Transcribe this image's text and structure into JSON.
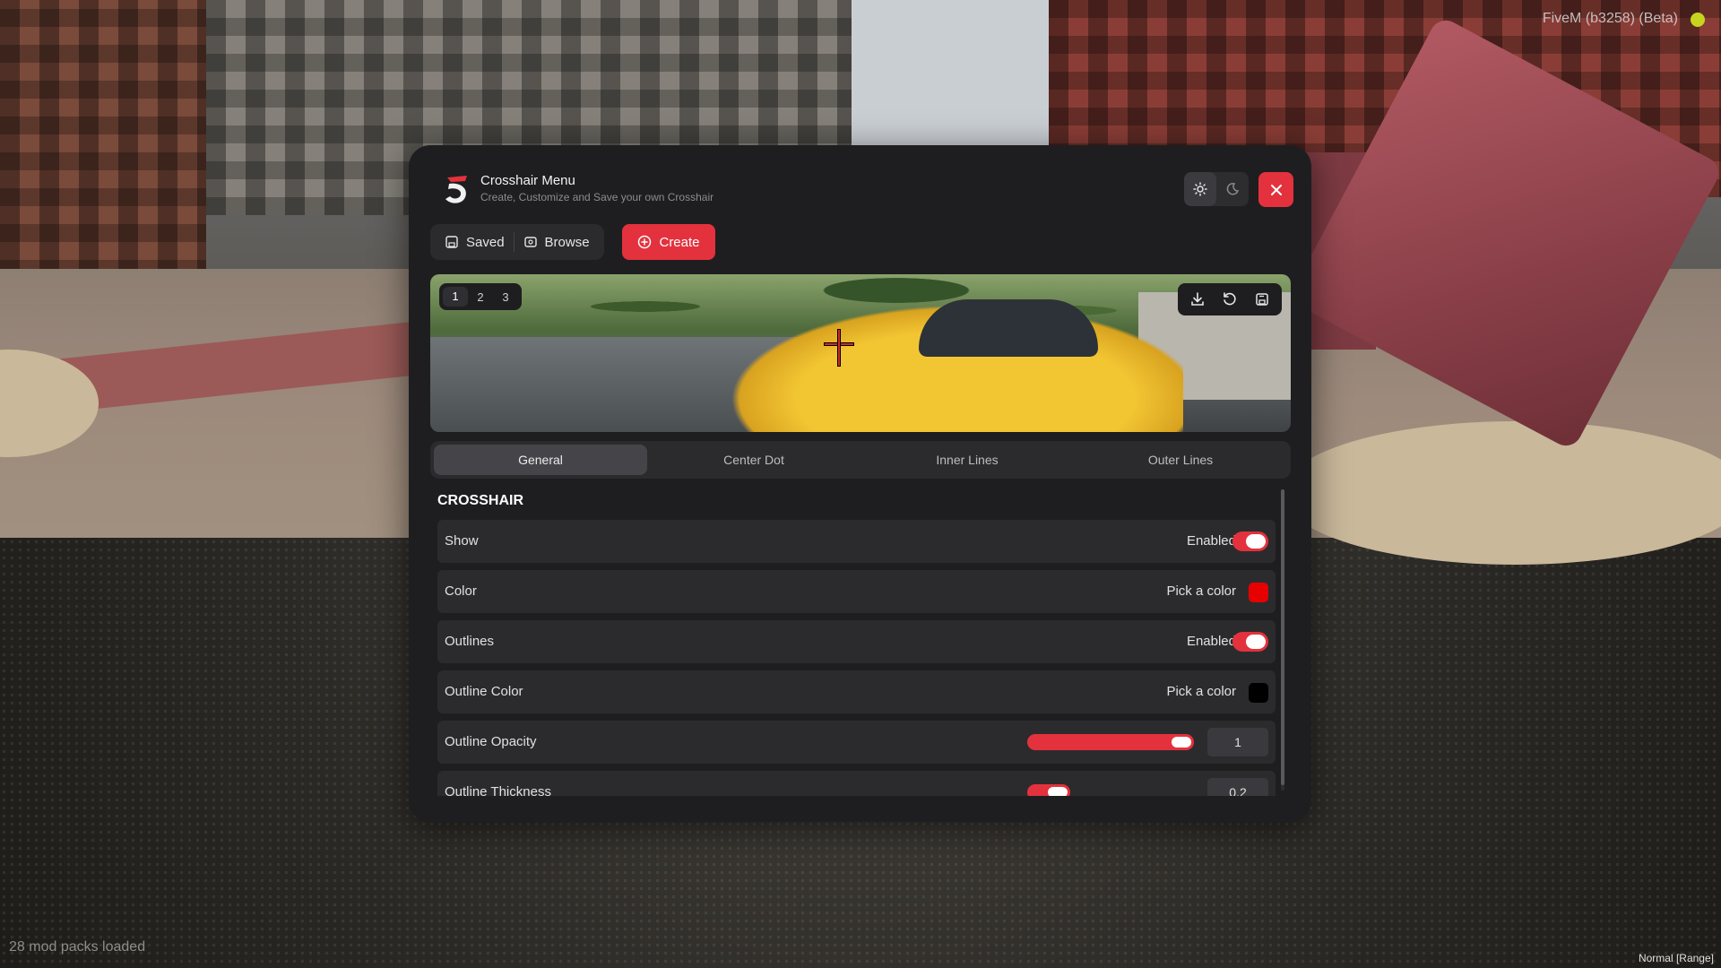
{
  "overlay": {
    "fivem_label": "FiveM (b3258) (Beta)",
    "mod_packs": "28 mod packs loaded",
    "mode_status": "Normal [Range]"
  },
  "panel": {
    "title": "Crosshair Menu",
    "subtitle": "Create, Customize and Save your own Crosshair",
    "theme": {
      "light_icon": "sun-icon",
      "dark_icon": "moon-icon",
      "active": "light"
    },
    "close_icon": "close-icon"
  },
  "nav": {
    "saved": "Saved",
    "browse": "Browse",
    "create": "Create"
  },
  "preview": {
    "pages": [
      "1",
      "2",
      "3"
    ],
    "active_page": "1",
    "actions": [
      "download-icon",
      "reset-icon",
      "save-icon"
    ]
  },
  "tabs": [
    "General",
    "Center Dot",
    "Inner Lines",
    "Outer Lines"
  ],
  "active_tab": "General",
  "section": {
    "title": "CROSSHAIR"
  },
  "settings": [
    {
      "label": "Show",
      "type": "toggle",
      "value": "Enabled"
    },
    {
      "label": "Color",
      "type": "color",
      "value": "Pick a color",
      "color": "#e60000"
    },
    {
      "label": "Outlines",
      "type": "toggle",
      "value": "Enabled"
    },
    {
      "label": "Outline Color",
      "type": "color",
      "value": "Pick a color",
      "color": "#000000"
    },
    {
      "label": "Outline Opacity",
      "type": "slider",
      "value": "1",
      "fraction": 1.0
    },
    {
      "label": "Outline Thickness",
      "type": "slider",
      "value": "0.2",
      "fraction": 0.2
    }
  ],
  "colors": {
    "accent": "#e3323d",
    "panel_bg": "#1e1e20",
    "row_bg": "#2b2b2e"
  }
}
